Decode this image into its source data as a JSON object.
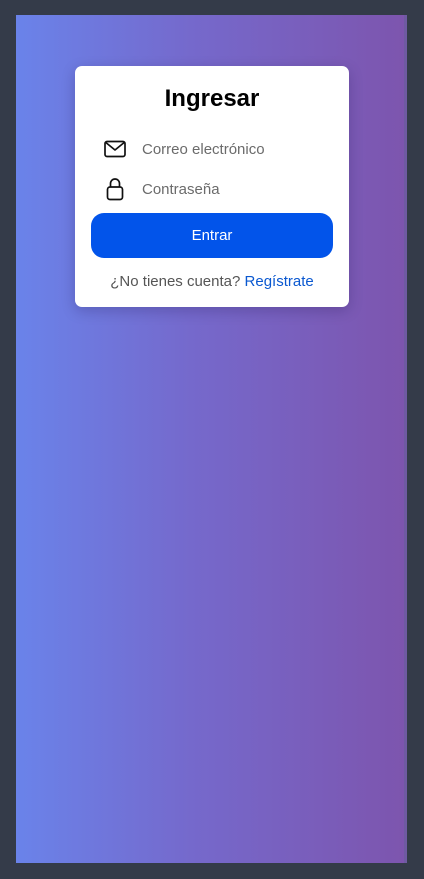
{
  "login": {
    "title": "Ingresar",
    "email": {
      "placeholder": "Correo electrónico",
      "value": "",
      "icon": "envelope-icon"
    },
    "password": {
      "placeholder": "Contraseña",
      "value": "",
      "icon": "lock-icon"
    },
    "submit_label": "Entrar",
    "signup_prompt": "¿No tienes cuenta?",
    "signup_link": "Regístrate"
  },
  "colors": {
    "page_background": "#343b49",
    "gradient_start": "#6a83ea",
    "gradient_end": "#7d55ae",
    "button": "#0254ea",
    "link": "#0a58d0"
  }
}
